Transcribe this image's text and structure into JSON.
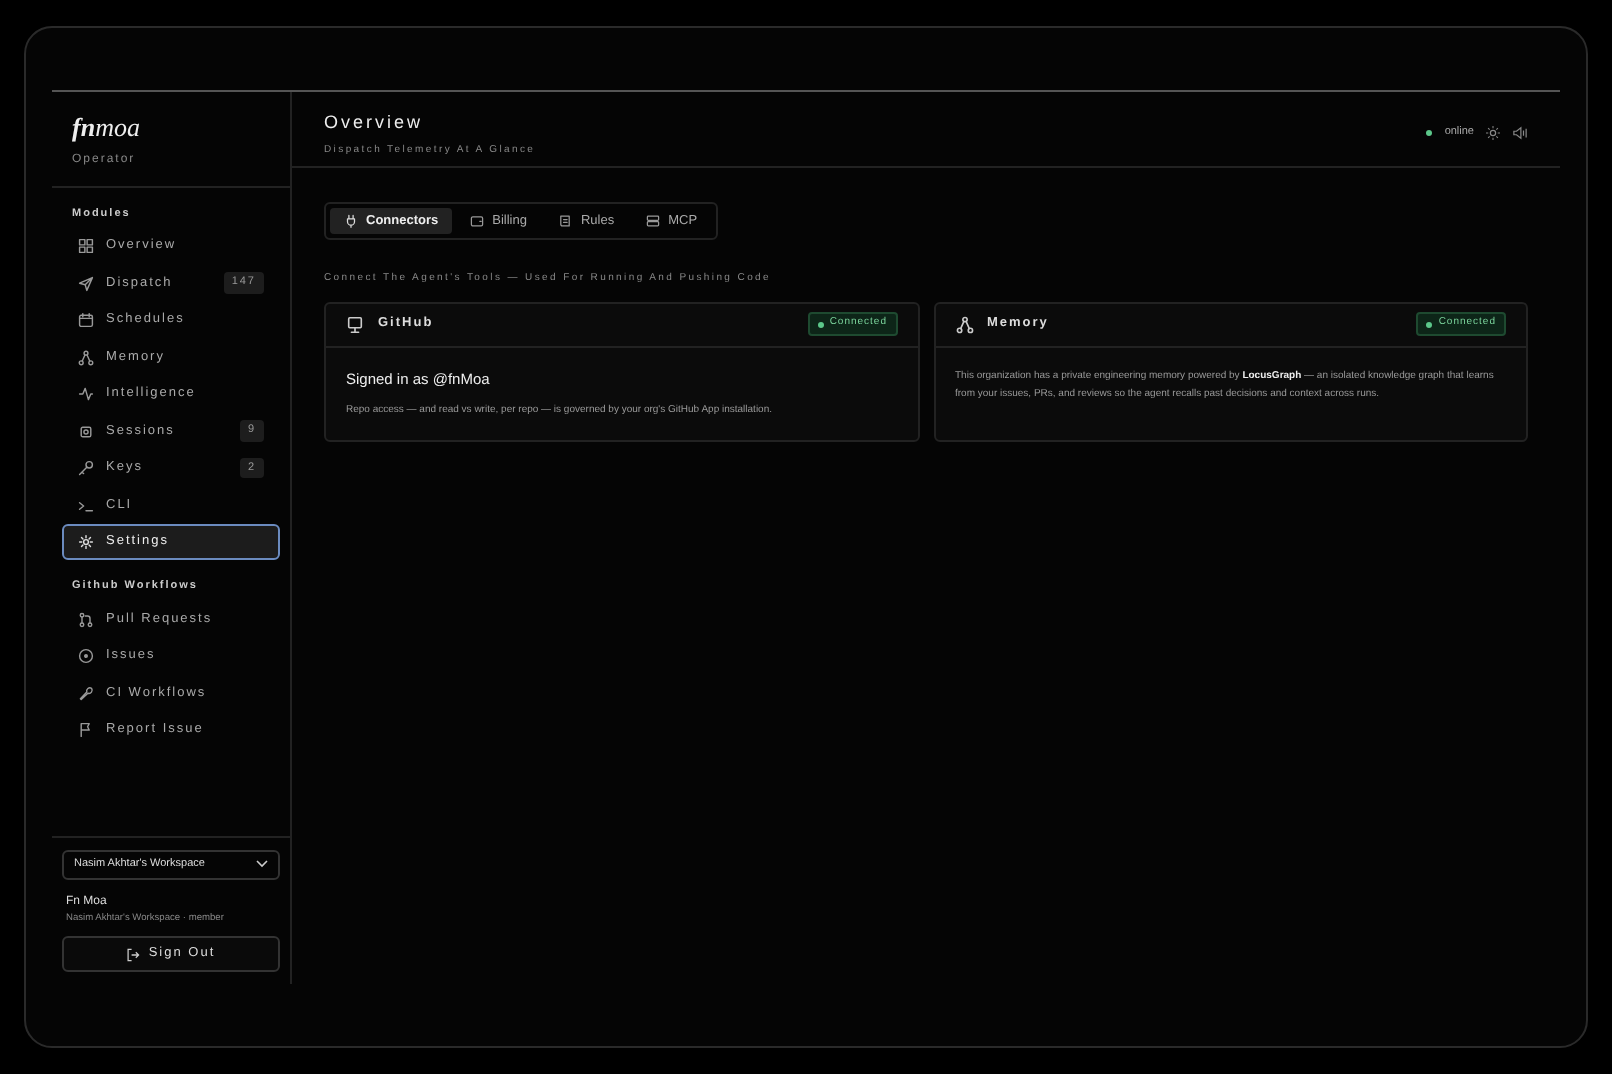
{
  "brand": {
    "logo": "**fn**moa",
    "role": "Operator"
  },
  "sidebar": [
    {
      "title": "Modules",
      "items": [
        {
          "label": "Overview",
          "selected": false
        },
        {
          "label": "Dispatch",
          "count": "147",
          "selected": false
        },
        {
          "label": "Schedules",
          "selected": false
        },
        {
          "label": "Memory",
          "selected": false
        },
        {
          "label": "Intelligence",
          "selected": false
        },
        {
          "label": "Sessions",
          "count": "9",
          "selected": false
        },
        {
          "label": "Keys",
          "count": "2",
          "selected": false
        },
        {
          "label": "CLI",
          "selected": false
        },
        {
          "label": "Settings",
          "selected": true
        }
      ]
    },
    {
      "title": "Github Workflows",
      "items": [
        {
          "label": "Pull Requests",
          "selected": false
        },
        {
          "label": "Issues",
          "selected": false
        },
        {
          "label": "CI Workflows",
          "selected": false
        },
        {
          "label": "Report Issue",
          "selected": false
        }
      ]
    }
  ],
  "workspace": {
    "select": "Nasim Akhtar's Workspace",
    "user_name": "Fn Moa",
    "user_detail": "Nasim Akhtar's Workspace · member",
    "sign_out": "Sign Out"
  },
  "header": {
    "title": "Overview",
    "subtitle": "Dispatch Telemetry At A Glance",
    "status": "online"
  },
  "tabs": [
    {
      "label": "Connectors",
      "selected": true
    },
    {
      "label": "Billing",
      "selected": false
    },
    {
      "label": "Rules",
      "selected": false
    },
    {
      "label": "MCP",
      "selected": false
    }
  ],
  "section_caption": "Connect The Agent's Tools — Used For Running And Pushing Code",
  "cards": [
    {
      "title": "GitHub",
      "status": "Connected",
      "heading": "Signed in as @fnMoa",
      "body": "Repo access — and read vs write, per repo — is governed by your org's GitHub App installation."
    },
    {
      "title": "Memory",
      "status": "Connected",
      "body": "This organization has a private engineering memory powered by **LocusGraph** — an isolated knowledge graph that learns from your issues, PRs, and reviews so the agent recalls past decisions and context across runs."
    }
  ]
}
